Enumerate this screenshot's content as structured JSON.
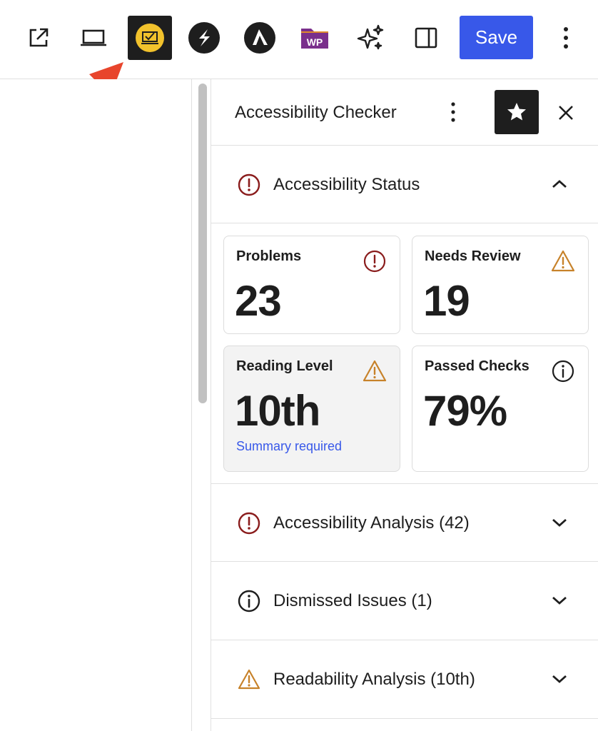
{
  "toolbar": {
    "items": [
      "external-link",
      "device-preview",
      "accessibility-checker",
      "plugin-s",
      "plugin-astra",
      "plugin-wp",
      "ai-sparkle",
      "sidebar-toggle"
    ],
    "wp_label": "WP",
    "save_label": "Save",
    "accent_color": "#3858e9"
  },
  "sidebar": {
    "title": "Accessibility Checker",
    "status_panel": {
      "label": "Accessibility Status",
      "expanded": true,
      "cards": {
        "problems": {
          "label": "Problems",
          "value": "23",
          "icon": "alert-circle-icon"
        },
        "needs_review": {
          "label": "Needs Review",
          "value": "19",
          "icon": "warning-triangle-icon"
        },
        "reading_level": {
          "label": "Reading Level",
          "value": "10th",
          "note": "Summary required",
          "icon": "warning-triangle-icon"
        },
        "passed_checks": {
          "label": "Passed Checks",
          "value": "79%",
          "icon": "info-circle-icon"
        }
      }
    },
    "panels": [
      {
        "label": "Accessibility Analysis (42)",
        "icon": "alert-circle-icon"
      },
      {
        "label": "Dismissed Issues (1)",
        "icon": "info-circle-icon"
      },
      {
        "label": "Readability Analysis (10th)",
        "icon": "warning-triangle-icon"
      }
    ]
  },
  "colors": {
    "problem_red": "#8a1c1c",
    "warning_orange": "#c7822a",
    "link_blue": "#3858e9"
  }
}
